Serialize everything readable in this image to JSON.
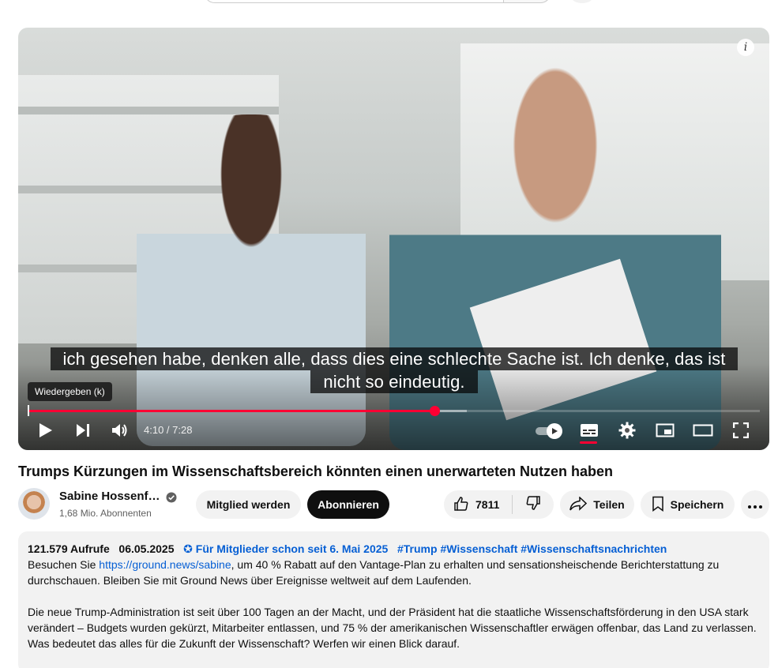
{
  "player": {
    "captions": [
      "ich gesehen habe, denken alle, dass dies eine schlechte Sache ist. Ich denke, das ist",
      "nicht so eindeutig."
    ],
    "tooltip": "Wiedergeben (k)",
    "time_display": "4:10 / 7:28",
    "progress": {
      "played_fraction": 0.556,
      "loaded_fraction": 0.6
    },
    "info_glyph": "i",
    "icons": [
      "play-icon",
      "next-icon",
      "volume-icon",
      "autoplay-toggle",
      "subtitles-icon",
      "settings-icon",
      "miniplayer-icon",
      "theater-icon",
      "fullscreen-icon"
    ]
  },
  "video": {
    "title": "Trumps Kürzungen im Wissenschaftsbereich könnten einen unerwarteten Nutzen haben"
  },
  "channel": {
    "name": "Sabine Hossenf…",
    "subscribers": "1,68 Mio. Abonnenten",
    "join_label": "Mitglied werden",
    "subscribe_label": "Abonnieren"
  },
  "actions": {
    "like_count": "7811",
    "share_label": "Teilen",
    "save_label": "Speichern"
  },
  "description": {
    "views": "121.579 Aufrufe",
    "date": "06.05.2025",
    "members_note": "✪ Für Mitglieder schon seit 6. Mai 2025",
    "hashtags": [
      "#Trump",
      "#Wissenschaft",
      "#Wissenschaftsnachrichten"
    ],
    "line1_prefix": "Besuchen Sie ",
    "link": "https://ground.news/sabine",
    "line1_suffix": ", um 40 % Rabatt auf den Vantage-Plan zu erhalten und sensationsheischende Berichterstattung zu durchschauen. Bleiben Sie mit Ground News über Ereignisse weltweit auf dem Laufenden.",
    "paragraph2": "Die neue Trump-Administration ist seit über 100 Tagen an der Macht, und der Präsident hat die staatliche Wissenschaftsförderung in den USA stark verändert – Budgets wurden gekürzt, Mitarbeiter entlassen, und 75 % der amerikanischen Wissenschaftler erwägen offenbar, das Land zu verlassen. Was bedeutet das alles für die Zukunft der Wissenschaft? Werfen wir einen Blick darauf."
  },
  "colors": {
    "accent_red": "#ff0033",
    "link_blue": "#065fd4",
    "chip_bg": "#f2f2f2"
  }
}
